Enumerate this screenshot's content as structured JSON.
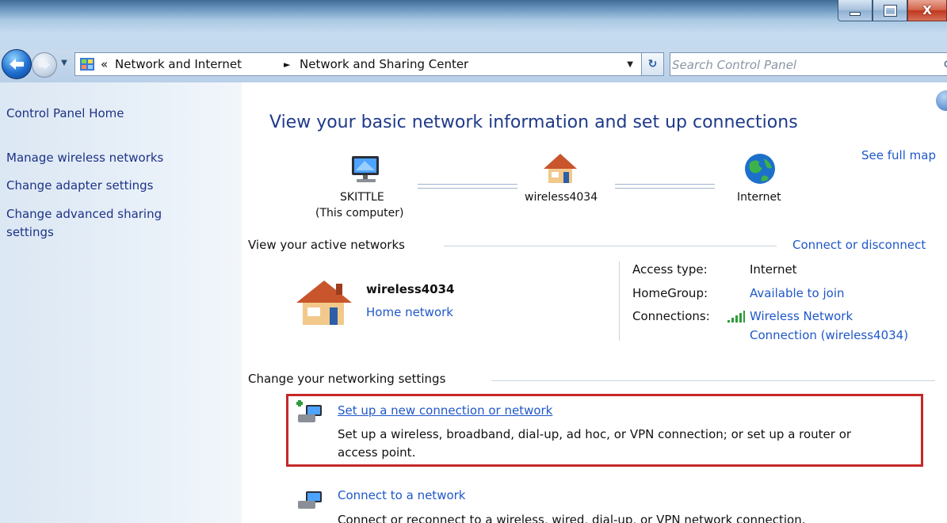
{
  "window": {
    "controls": {
      "minimize": "minimize",
      "maximize": "maximize",
      "close": "close"
    },
    "close_glyph": "X"
  },
  "navigation": {
    "back_icon": "back-arrow-icon",
    "forward_icon": "forward-arrow-icon",
    "history_dropdown_glyph": "▼",
    "address": {
      "overflow_chevron": "«",
      "crumbs": [
        "Network and Internet",
        "Network and Sharing Center"
      ],
      "separator": "►",
      "dropdown_glyph": "▼"
    },
    "refresh_glyph": "↻",
    "search": {
      "placeholder": "Search Control Panel",
      "icon": "search-icon"
    }
  },
  "sidebar": {
    "items": [
      {
        "label": "Control Panel Home"
      },
      {
        "label": "Manage wireless networks"
      },
      {
        "label": "Change adapter settings"
      },
      {
        "label": "Change advanced sharing"
      },
      {
        "label": "settings"
      }
    ]
  },
  "main": {
    "title": "View your basic network information and set up connections",
    "see_full_map": "See full map",
    "network_map": {
      "computer": {
        "name": "SKITTLE",
        "note": "(This computer)"
      },
      "network": {
        "name": "wireless4034"
      },
      "internet": {
        "name": "Internet"
      }
    },
    "active_networks": {
      "heading": "View your active networks",
      "connect_link": "Connect or disconnect",
      "network_name": "wireless4034",
      "network_category": "Home network",
      "access_type_label": "Access type:",
      "access_type_value": "Internet",
      "homegroup_label": "HomeGroup:",
      "homegroup_value": "Available to join",
      "connections_label": "Connections:",
      "connection_line1": "Wireless Network",
      "connection_line2": "Connection (wireless4034)"
    },
    "networking_settings": {
      "heading": "Change your networking settings",
      "tasks": [
        {
          "title": "Set up a new connection or network",
          "desc_line1": "Set up a wireless, broadband, dial-up, ad hoc, or VPN connection; or set up a router or",
          "desc_line2": "access point."
        },
        {
          "title": "Connect to a network",
          "desc_line1": "Connect or reconnect to a wireless, wired, dial-up, or VPN network connection."
        }
      ]
    }
  },
  "colors": {
    "link": "#1f58c8",
    "highlight_border": "#c62828",
    "title": "#1e3a8a"
  }
}
